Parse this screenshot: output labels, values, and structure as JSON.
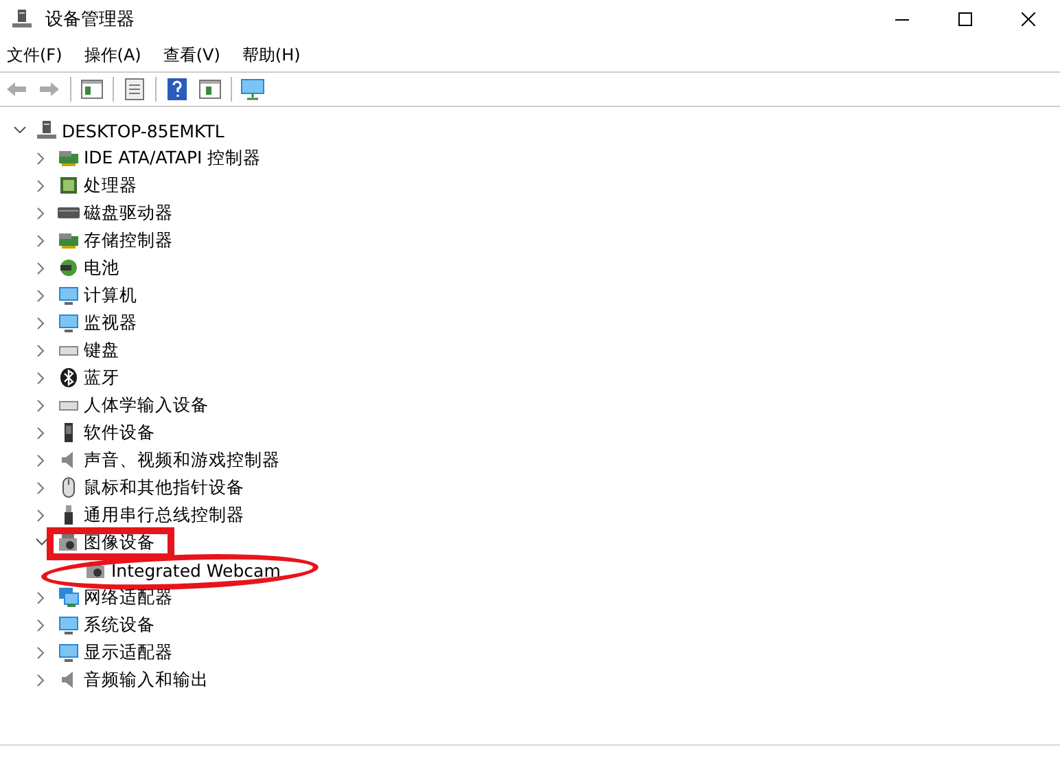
{
  "window": {
    "title": "设备管理器"
  },
  "menu": [
    "文件(F)",
    "操作(A)",
    "查看(V)",
    "帮助(H)"
  ],
  "tree": {
    "label": "DESKTOP-85EMKTL",
    "expanded": true,
    "children": [
      {
        "label": "IDE ATA/ATAPI 控制器",
        "expanded": false,
        "kind": "plain"
      },
      {
        "label": "处理器",
        "expanded": false,
        "kind": "plain"
      },
      {
        "label": "磁盘驱动器",
        "expanded": false,
        "kind": "plain"
      },
      {
        "label": "存储控制器",
        "expanded": false,
        "kind": "plain"
      },
      {
        "label": "电池",
        "expanded": false,
        "kind": "plain"
      },
      {
        "label": "计算机",
        "expanded": false,
        "kind": "plain"
      },
      {
        "label": "监视器",
        "expanded": false,
        "kind": "plain"
      },
      {
        "label": "键盘",
        "expanded": false,
        "kind": "plain"
      },
      {
        "label": "蓝牙",
        "expanded": false,
        "kind": "plain"
      },
      {
        "label": "人体学输入设备",
        "expanded": false,
        "kind": "plain"
      },
      {
        "label": "软件设备",
        "expanded": false,
        "kind": "plain"
      },
      {
        "label": "声音、视频和游戏控制器",
        "expanded": false,
        "kind": "plain"
      },
      {
        "label": "鼠标和其他指针设备",
        "expanded": false,
        "kind": "plain"
      },
      {
        "label": "通用串行总线控制器",
        "expanded": false,
        "kind": "plain"
      },
      {
        "label": "图像设备",
        "expanded": true,
        "kind": "boxed",
        "children": [
          {
            "label": "Integrated Webcam",
            "kind": "circled"
          }
        ]
      },
      {
        "label": "网络适配器",
        "expanded": false,
        "kind": "plain"
      },
      {
        "label": "系统设备",
        "expanded": false,
        "kind": "plain"
      },
      {
        "label": "显示适配器",
        "expanded": false,
        "kind": "plain"
      },
      {
        "label": "音频输入和输出",
        "expanded": false,
        "kind": "plain"
      }
    ]
  }
}
